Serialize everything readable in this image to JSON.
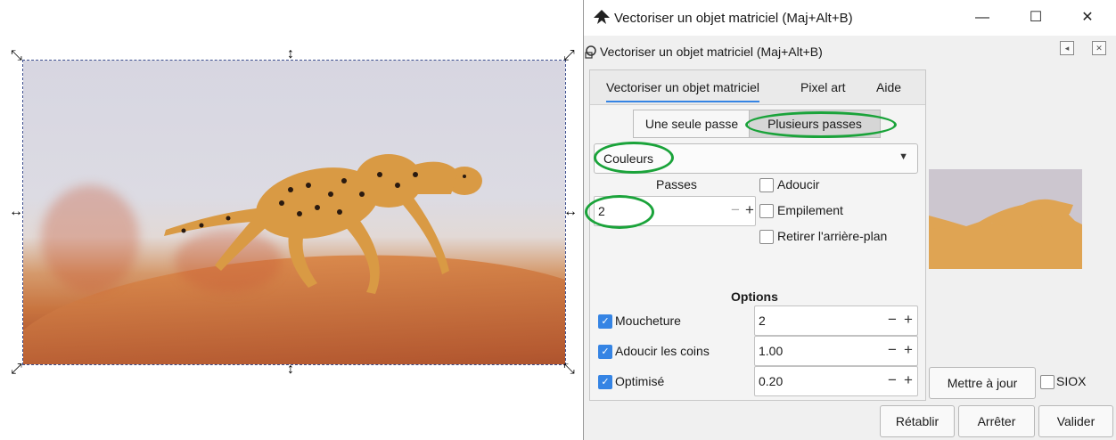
{
  "dialog": {
    "title": "Vectoriser un objet matriciel (Maj+Alt+B)",
    "subtitle": "Vectoriser un objet matriciel (Maj+Alt+B)",
    "window_buttons": {
      "minimize": "—",
      "maximize": "☐",
      "close": "✕"
    },
    "tabs": [
      "Vectoriser un objet matriciel",
      "Pixel art",
      "Aide"
    ],
    "modes": [
      "Une seule passe",
      "Plusieurs passes"
    ],
    "selected_mode": "Plusieurs passes",
    "combo_value": "Couleurs",
    "passes_label": "Passes",
    "passes_value": "2",
    "checks_right": [
      {
        "label": "Adoucir",
        "checked": false
      },
      {
        "label": "Empilement",
        "checked": false
      },
      {
        "label": "Retirer l'arrière-plan",
        "checked": false
      }
    ],
    "options_title": "Options",
    "options": [
      {
        "label": "Moucheture",
        "checked": true,
        "value": "2"
      },
      {
        "label": "Adoucir les coins",
        "checked": true,
        "value": "1.00"
      },
      {
        "label": "Optimisé",
        "checked": true,
        "value": "0.20"
      }
    ],
    "update_button": "Mettre à jour",
    "siox_label": "SIOX",
    "footer_buttons": [
      "Rétablir",
      "Arrêter",
      "Valider"
    ]
  },
  "colors": {
    "accent": "#3584e4",
    "annotation": "#1aa33a",
    "preview_bg": "#ccc6cf",
    "preview_fg": "#dfa453"
  }
}
